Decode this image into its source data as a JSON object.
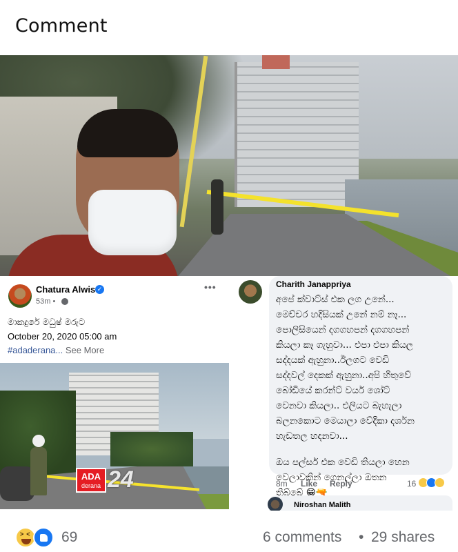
{
  "header": {
    "title": "Comment"
  },
  "post": {
    "author": "Chatura Alwis",
    "time": "53m •",
    "line1": "මාකදුරේ මධුෂ් මරුට",
    "line2": "October 20, 2020   05:00 am",
    "hashtag": "#adaderana...",
    "see_more": " See More",
    "photo_logo": {
      "brand": "ADA",
      "sub": "derana",
      "channel": "24"
    }
  },
  "comment": {
    "author": "Charith Janappriya",
    "lines": [
      "අපේ ක්වාට්ස් එක ලග උනේ...",
      "මෙච්චර හදිසියක් උනේ නම් නෑ...",
      "පොලිසියෙන් දගගහපන් දගගහපන්",
      "කියලා කෑ ගැහුවා... එපා එපා කියල",
      "සද්දයක් ඇහුනා..ඊලගට වෙඩි",
      "සද්දවල් දෙකක් ඇහුනා..අපි හිතුවේ",
      "බෝඩියේ කරන්ට් වයර් ශෝට්",
      "වෙනවා කියලා.. එලියට බැහැලා",
      "බලනකොට මෙයාලා වේදිකා දර්ශන",
      "හැඩතල හදනවා..."
    ],
    "lines2": [
      "ඔය පල්සර් එක වෙඩි තියලා හෙන",
      "වෙලාවකින් ගෙනල්ලා ඔතන",
      "තිබ්බේ 😁🔫"
    ],
    "time": "8m",
    "like": "Like",
    "reply": "Reply",
    "reactions": "16",
    "reply_preview": "Niroshan Malith"
  },
  "footer": {
    "reaction_count": "69",
    "comments": "6 comments",
    "separator": "•",
    "shares": "29 shares"
  },
  "colors": {
    "accent": "#1877f2",
    "text_muted": "#65676b",
    "link": "#385898",
    "bubble": "#f0f2f5"
  }
}
